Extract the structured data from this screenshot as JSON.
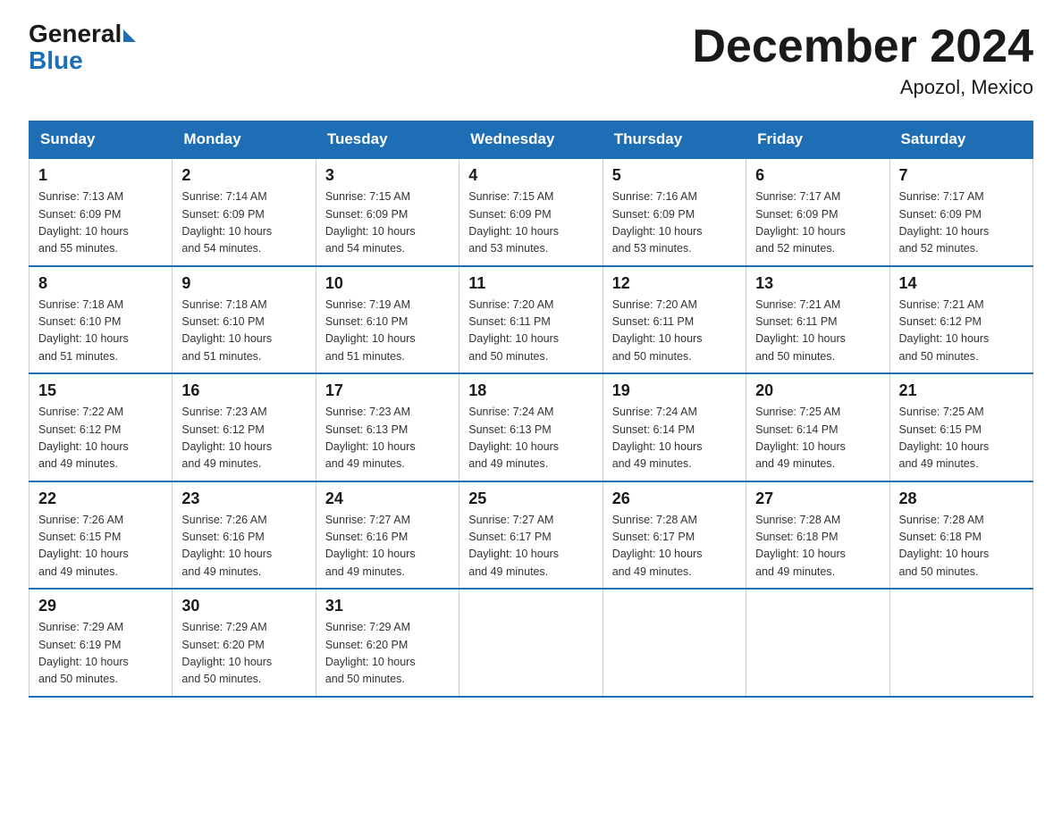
{
  "header": {
    "logo_general": "General",
    "logo_blue": "Blue",
    "title": "December 2024",
    "location": "Apozol, Mexico"
  },
  "days_of_week": [
    "Sunday",
    "Monday",
    "Tuesday",
    "Wednesday",
    "Thursday",
    "Friday",
    "Saturday"
  ],
  "weeks": [
    [
      {
        "day": "1",
        "info": "Sunrise: 7:13 AM\nSunset: 6:09 PM\nDaylight: 10 hours\nand 55 minutes."
      },
      {
        "day": "2",
        "info": "Sunrise: 7:14 AM\nSunset: 6:09 PM\nDaylight: 10 hours\nand 54 minutes."
      },
      {
        "day": "3",
        "info": "Sunrise: 7:15 AM\nSunset: 6:09 PM\nDaylight: 10 hours\nand 54 minutes."
      },
      {
        "day": "4",
        "info": "Sunrise: 7:15 AM\nSunset: 6:09 PM\nDaylight: 10 hours\nand 53 minutes."
      },
      {
        "day": "5",
        "info": "Sunrise: 7:16 AM\nSunset: 6:09 PM\nDaylight: 10 hours\nand 53 minutes."
      },
      {
        "day": "6",
        "info": "Sunrise: 7:17 AM\nSunset: 6:09 PM\nDaylight: 10 hours\nand 52 minutes."
      },
      {
        "day": "7",
        "info": "Sunrise: 7:17 AM\nSunset: 6:09 PM\nDaylight: 10 hours\nand 52 minutes."
      }
    ],
    [
      {
        "day": "8",
        "info": "Sunrise: 7:18 AM\nSunset: 6:10 PM\nDaylight: 10 hours\nand 51 minutes."
      },
      {
        "day": "9",
        "info": "Sunrise: 7:18 AM\nSunset: 6:10 PM\nDaylight: 10 hours\nand 51 minutes."
      },
      {
        "day": "10",
        "info": "Sunrise: 7:19 AM\nSunset: 6:10 PM\nDaylight: 10 hours\nand 51 minutes."
      },
      {
        "day": "11",
        "info": "Sunrise: 7:20 AM\nSunset: 6:11 PM\nDaylight: 10 hours\nand 50 minutes."
      },
      {
        "day": "12",
        "info": "Sunrise: 7:20 AM\nSunset: 6:11 PM\nDaylight: 10 hours\nand 50 minutes."
      },
      {
        "day": "13",
        "info": "Sunrise: 7:21 AM\nSunset: 6:11 PM\nDaylight: 10 hours\nand 50 minutes."
      },
      {
        "day": "14",
        "info": "Sunrise: 7:21 AM\nSunset: 6:12 PM\nDaylight: 10 hours\nand 50 minutes."
      }
    ],
    [
      {
        "day": "15",
        "info": "Sunrise: 7:22 AM\nSunset: 6:12 PM\nDaylight: 10 hours\nand 49 minutes."
      },
      {
        "day": "16",
        "info": "Sunrise: 7:23 AM\nSunset: 6:12 PM\nDaylight: 10 hours\nand 49 minutes."
      },
      {
        "day": "17",
        "info": "Sunrise: 7:23 AM\nSunset: 6:13 PM\nDaylight: 10 hours\nand 49 minutes."
      },
      {
        "day": "18",
        "info": "Sunrise: 7:24 AM\nSunset: 6:13 PM\nDaylight: 10 hours\nand 49 minutes."
      },
      {
        "day": "19",
        "info": "Sunrise: 7:24 AM\nSunset: 6:14 PM\nDaylight: 10 hours\nand 49 minutes."
      },
      {
        "day": "20",
        "info": "Sunrise: 7:25 AM\nSunset: 6:14 PM\nDaylight: 10 hours\nand 49 minutes."
      },
      {
        "day": "21",
        "info": "Sunrise: 7:25 AM\nSunset: 6:15 PM\nDaylight: 10 hours\nand 49 minutes."
      }
    ],
    [
      {
        "day": "22",
        "info": "Sunrise: 7:26 AM\nSunset: 6:15 PM\nDaylight: 10 hours\nand 49 minutes."
      },
      {
        "day": "23",
        "info": "Sunrise: 7:26 AM\nSunset: 6:16 PM\nDaylight: 10 hours\nand 49 minutes."
      },
      {
        "day": "24",
        "info": "Sunrise: 7:27 AM\nSunset: 6:16 PM\nDaylight: 10 hours\nand 49 minutes."
      },
      {
        "day": "25",
        "info": "Sunrise: 7:27 AM\nSunset: 6:17 PM\nDaylight: 10 hours\nand 49 minutes."
      },
      {
        "day": "26",
        "info": "Sunrise: 7:28 AM\nSunset: 6:17 PM\nDaylight: 10 hours\nand 49 minutes."
      },
      {
        "day": "27",
        "info": "Sunrise: 7:28 AM\nSunset: 6:18 PM\nDaylight: 10 hours\nand 49 minutes."
      },
      {
        "day": "28",
        "info": "Sunrise: 7:28 AM\nSunset: 6:18 PM\nDaylight: 10 hours\nand 50 minutes."
      }
    ],
    [
      {
        "day": "29",
        "info": "Sunrise: 7:29 AM\nSunset: 6:19 PM\nDaylight: 10 hours\nand 50 minutes."
      },
      {
        "day": "30",
        "info": "Sunrise: 7:29 AM\nSunset: 6:20 PM\nDaylight: 10 hours\nand 50 minutes."
      },
      {
        "day": "31",
        "info": "Sunrise: 7:29 AM\nSunset: 6:20 PM\nDaylight: 10 hours\nand 50 minutes."
      },
      {
        "day": "",
        "info": ""
      },
      {
        "day": "",
        "info": ""
      },
      {
        "day": "",
        "info": ""
      },
      {
        "day": "",
        "info": ""
      }
    ]
  ]
}
